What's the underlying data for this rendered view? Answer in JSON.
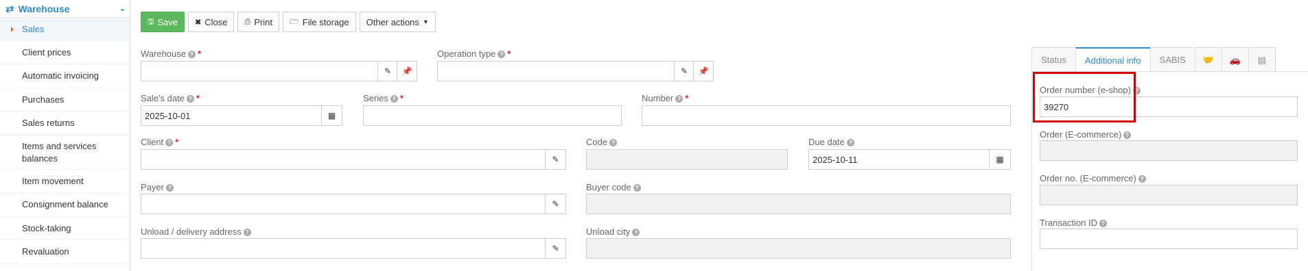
{
  "sidebar": {
    "header": "Warehouse",
    "items": [
      {
        "label": "Sales",
        "active": true
      },
      {
        "label": "Client prices"
      },
      {
        "label": "Automatic invoicing"
      },
      {
        "label": "Purchases"
      },
      {
        "label": "Sales returns"
      },
      {
        "label": "Items and services balances"
      },
      {
        "label": "Item movement"
      },
      {
        "label": "Consignment balance"
      },
      {
        "label": "Stock-taking"
      },
      {
        "label": "Revaluation"
      }
    ]
  },
  "toolbar": {
    "save_label": "Save",
    "close_label": "Close",
    "print_label": "Print",
    "file_storage_label": "File storage",
    "other_actions_label": "Other actions"
  },
  "form": {
    "warehouse": {
      "label": "Warehouse",
      "value": ""
    },
    "operation_type": {
      "label": "Operation type",
      "value": ""
    },
    "sales_date": {
      "label": "Sale's date",
      "value": "2025-10-01"
    },
    "series": {
      "label": "Series",
      "value": ""
    },
    "number": {
      "label": "Number",
      "value": ""
    },
    "client": {
      "label": "Client",
      "value": ""
    },
    "code": {
      "label": "Code",
      "value": ""
    },
    "due_date": {
      "label": "Due date",
      "value": "2025-10-11"
    },
    "payer": {
      "label": "Payer",
      "value": ""
    },
    "buyer_code": {
      "label": "Buyer code",
      "value": ""
    },
    "unload_address": {
      "label": "Unload / delivery address",
      "value": ""
    },
    "unload_city": {
      "label": "Unload city",
      "value": ""
    }
  },
  "right_panel": {
    "tabs": [
      {
        "label": "Status"
      },
      {
        "label": "Additional info",
        "active": true
      },
      {
        "label": "SABIS"
      },
      {
        "icon": "handshake-icon"
      },
      {
        "icon": "car-icon"
      },
      {
        "icon": "archive-icon"
      }
    ],
    "order_number_eshop": {
      "label": "Order number (e-shop)",
      "value": "39270"
    },
    "order_ecommerce": {
      "label": "Order (E-commerce)",
      "value": ""
    },
    "order_no_ecommerce": {
      "label": "Order no. (E-commerce)",
      "value": ""
    },
    "transaction_id": {
      "label": "Transaction ID",
      "value": ""
    }
  },
  "colors": {
    "accent": "#2a8bd0",
    "save": "#5cb85c",
    "required": "#d9262c",
    "highlight": "#d50000"
  }
}
